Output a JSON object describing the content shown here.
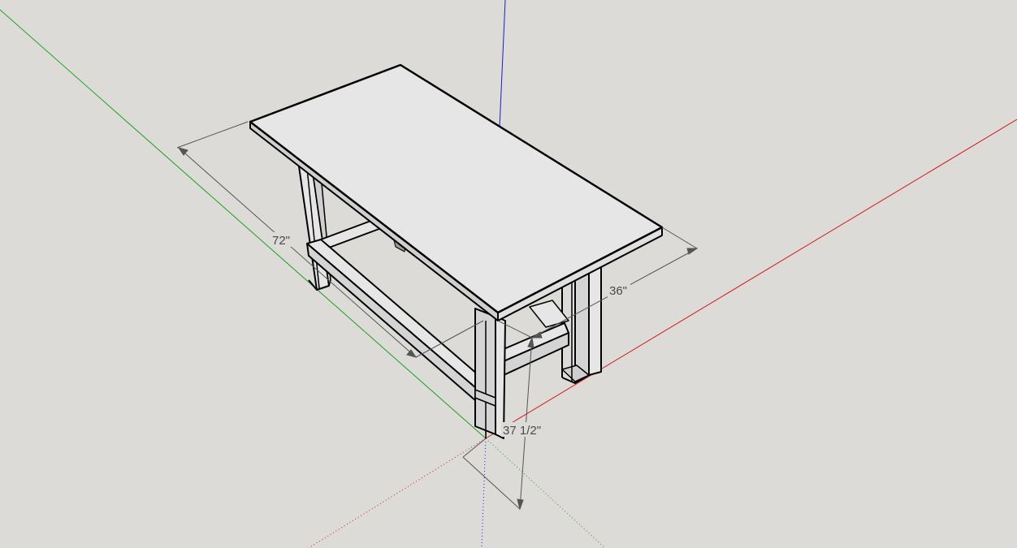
{
  "viewport": {
    "background": "#dddbd8",
    "axes": {
      "x_color": "#d11a1a",
      "y_color": "#1aa31a",
      "z_color": "#1a1ad1"
    }
  },
  "model": {
    "name": "table",
    "top_face_color": "#e6e6e6",
    "side_color": "#d2d2d2",
    "edge_color": "#000000"
  },
  "dimensions": {
    "length": "72\"",
    "width": "36\"",
    "height": "37 1/2\""
  }
}
